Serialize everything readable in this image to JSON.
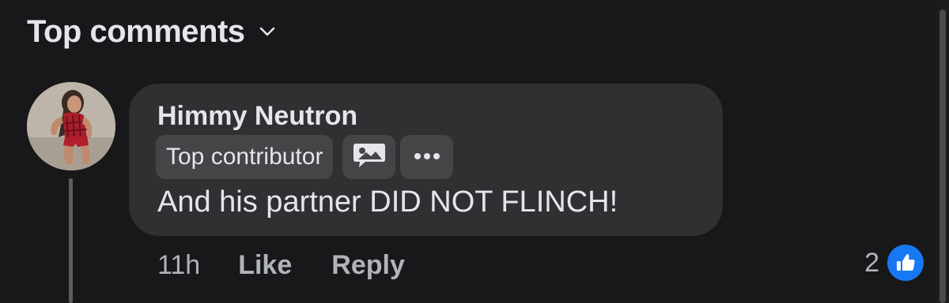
{
  "header": {
    "title": "Top comments",
    "chevron_icon": "chevron-down-icon"
  },
  "comment": {
    "author": "Himmy Neutron",
    "badge": "Top contributor",
    "badge_icon": "image-speech-bubble-icon",
    "more_icon": "more-options-icon",
    "text": "And his partner DID NOT FLINCH!",
    "time": "11h",
    "like_label": "Like",
    "reply_label": "Reply",
    "reaction_count": "2",
    "reaction_icon": "thumbs-up-icon"
  },
  "colors": {
    "background": "#18181a",
    "bubble": "#303032",
    "chip": "#454548",
    "text": "#e4e6eb",
    "muted": "#b0b3b8",
    "like_blue": "#1877f2"
  }
}
